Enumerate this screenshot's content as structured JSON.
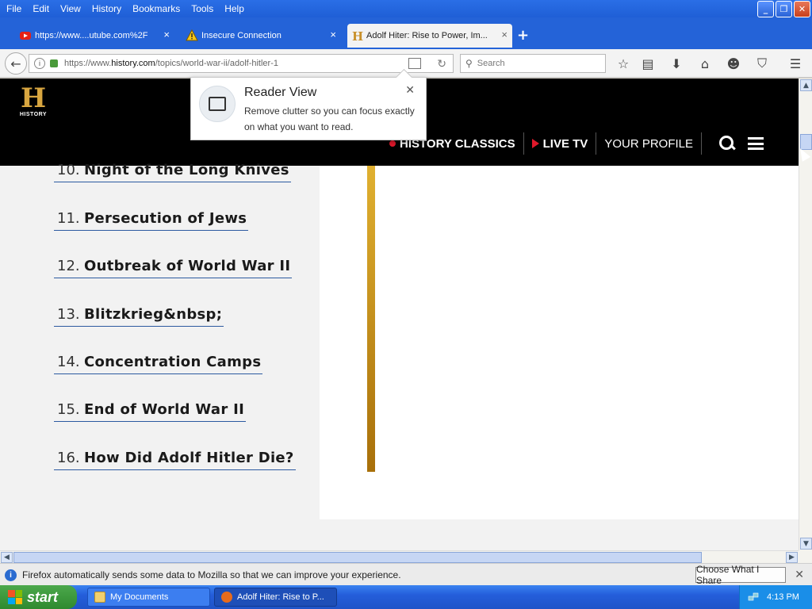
{
  "menubar": {
    "items": [
      {
        "label": "File"
      },
      {
        "label": "Edit"
      },
      {
        "label": "View"
      },
      {
        "label": "History"
      },
      {
        "label": "Bookmarks"
      },
      {
        "label": "Tools"
      },
      {
        "label": "Help"
      }
    ]
  },
  "tabs": [
    {
      "label": "https://www....utube.com%2F",
      "icon": "youtube-icon"
    },
    {
      "label": "Insecure Connection",
      "icon": "warning-icon"
    },
    {
      "label": "Adolf Hiter: Rise to Power, Im...",
      "icon": "history-favicon",
      "active": true
    }
  ],
  "navbar": {
    "url_prefix": "https://www.",
    "url_domain": "history.com",
    "url_path": "/topics/world-war-ii/adolf-hitler-1",
    "search_placeholder": "Search"
  },
  "site": {
    "logo_text": "HISTORY",
    "nav": [
      {
        "label": "HISTORY CLASSICS"
      },
      {
        "label": "LIVE TV"
      },
      {
        "label": "YOUR PROFILE"
      }
    ]
  },
  "toc": [
    {
      "num": "10.",
      "label": "Night of the Long Knives"
    },
    {
      "num": "11.",
      "label": "Persecution of Jews"
    },
    {
      "num": "12.",
      "label": "Outbreak of World War II"
    },
    {
      "num": "13.",
      "label": "Blitzkrieg&nbsp;"
    },
    {
      "num": "14.",
      "label": "Concentration Camps"
    },
    {
      "num": "15.",
      "label": "End of World War II"
    },
    {
      "num": "16.",
      "label": "How Did Adolf Hitler Die?"
    }
  ],
  "reader_popup": {
    "title": "Reader View",
    "description": "Remove clutter so you can focus exactly on what you want to read."
  },
  "notification": {
    "text": "Firefox automatically sends some data to Mozilla so that we can improve your experience.",
    "button": "Choose What I Share"
  },
  "taskbar": {
    "start": "start",
    "items": [
      {
        "label": "My Documents"
      },
      {
        "label": "Adolf Hiter: Rise to P..."
      }
    ],
    "clock": "4:13 PM"
  },
  "colors": {
    "accent_gold": "#d8a640",
    "live_red": "#e0182b",
    "toc_underline": "#2c5aa0"
  }
}
